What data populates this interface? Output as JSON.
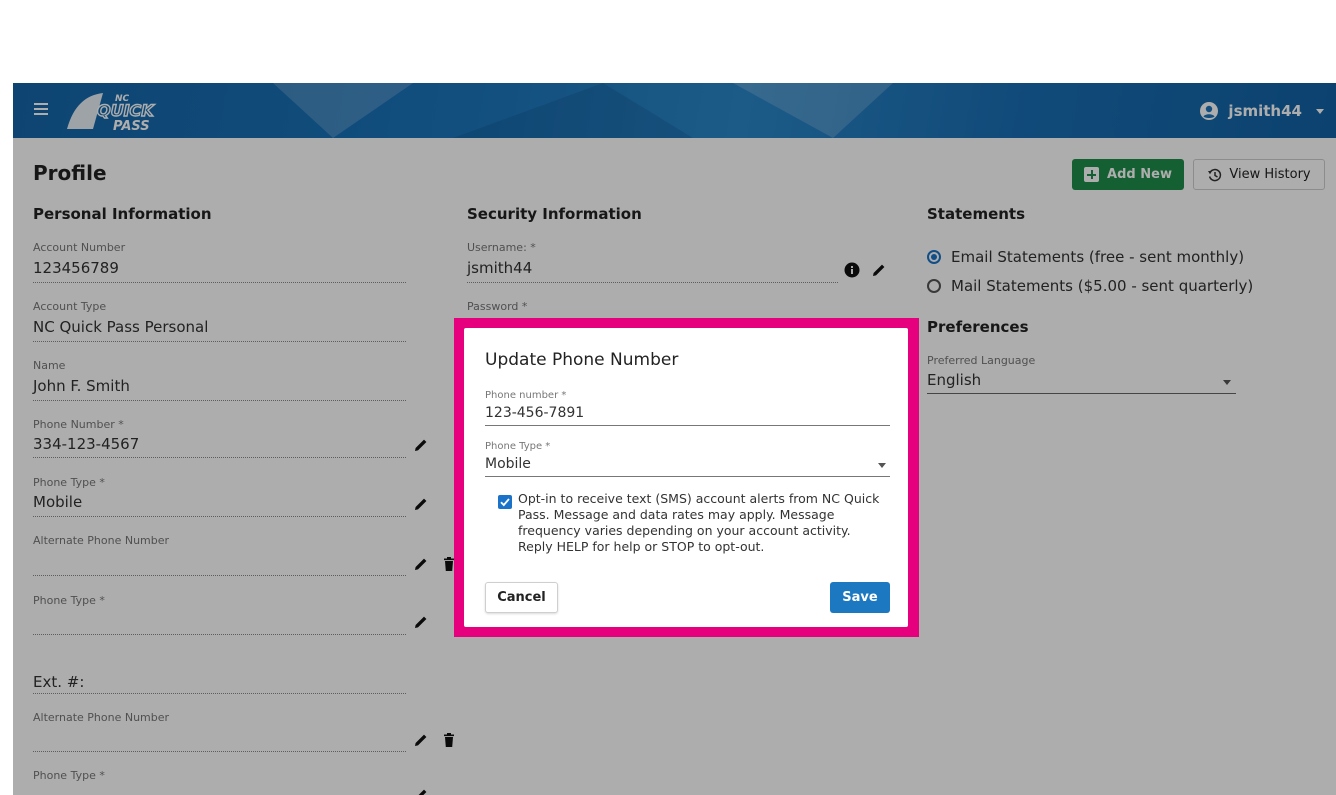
{
  "header": {
    "logo_top": "NC",
    "logo_main": "QUICK",
    "logo_sub": "PASS",
    "username": "jsmith44"
  },
  "page": {
    "title": "Profile",
    "add_new_label": "Add New",
    "view_history_label": "View History"
  },
  "personal": {
    "title": "Personal Information",
    "fields": [
      {
        "label": "Account Number",
        "value": "123456789"
      },
      {
        "label": "Account Type",
        "value": "NC Quick Pass Personal"
      },
      {
        "label": "Name",
        "value": "John F. Smith"
      },
      {
        "label": "Phone Number *",
        "value": "334-123-4567"
      },
      {
        "label": "Phone Type *",
        "value": "Mobile"
      },
      {
        "label": "Alternate Phone Number",
        "value": ""
      },
      {
        "label": "Phone Type *",
        "value": ""
      },
      {
        "label": "",
        "value": "Ext. #:"
      },
      {
        "label": "Alternate Phone Number",
        "value": ""
      },
      {
        "label": "Phone Type *",
        "value": ""
      }
    ]
  },
  "security": {
    "title": "Security Information",
    "username_label": "Username: *",
    "username_value": "jsmith44",
    "password_label": "Password *"
  },
  "statements": {
    "title": "Statements",
    "options": [
      {
        "label": "Email Statements (free - sent monthly)",
        "selected": true
      },
      {
        "label": "Mail Statements ($5.00 - sent quarterly)",
        "selected": false
      }
    ]
  },
  "preferences": {
    "title": "Preferences",
    "language_label": "Preferred Language",
    "language_value": "English"
  },
  "modal": {
    "title": "Update Phone Number",
    "phone_label": "Phone number *",
    "phone_value": "123-456-7891",
    "type_label": "Phone Type *",
    "type_value": "Mobile",
    "consent_checked": true,
    "consent_text": "Opt-in to receive text (SMS) account alerts from NC Quick Pass. Message and data rates may apply. Message frequency varies depending on your account activity. Reply HELP for help or STOP to opt-out.",
    "cancel_label": "Cancel",
    "save_label": "Save"
  },
  "colors": {
    "header_blue": "#1b75bb",
    "add_green": "#1e8e4a",
    "primary_blue": "#1c78c0",
    "highlight_magenta": "#e6007e"
  }
}
